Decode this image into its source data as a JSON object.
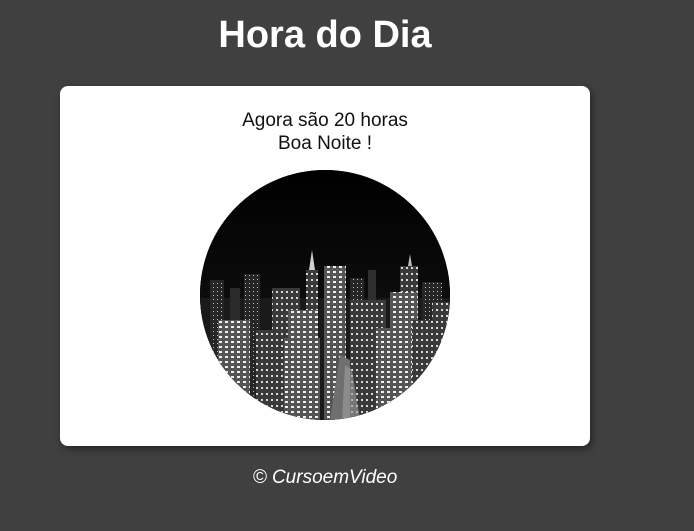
{
  "header": {
    "title": "Hora do Dia"
  },
  "card": {
    "time_message": "Agora são 20 horas",
    "greeting": "Boa Noite !",
    "image": {
      "subject": "night-city-skyline",
      "tone": "grayscale"
    }
  },
  "footer": {
    "copyright": "© CursoemVideo"
  },
  "colors": {
    "background": "#404040",
    "card": "#ffffff",
    "title": "#ffffff",
    "text": "#111111"
  }
}
